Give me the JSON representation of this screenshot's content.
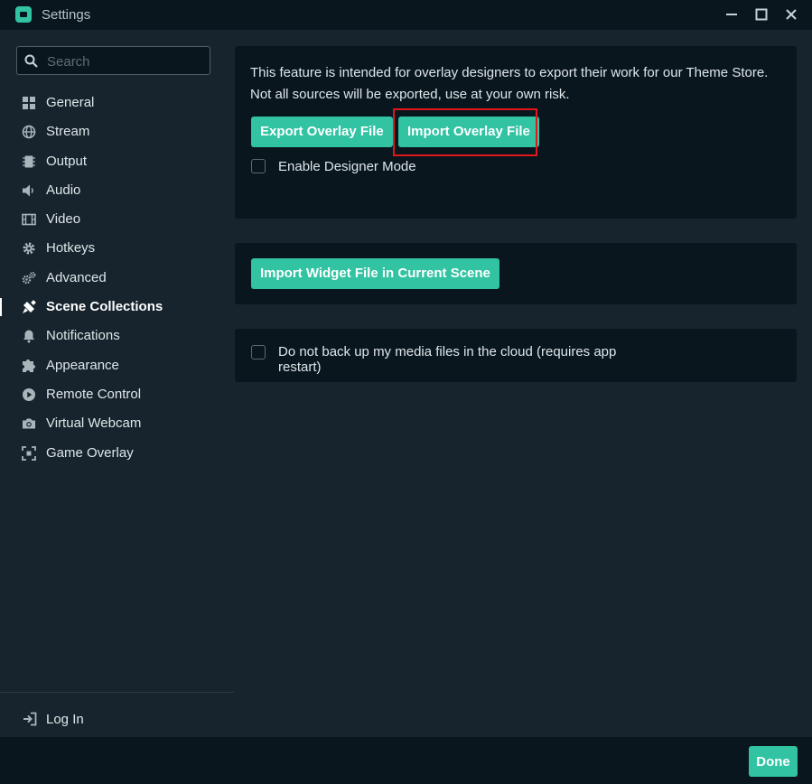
{
  "window": {
    "title": "Settings",
    "controls": {
      "minimize": "—",
      "maximize": "☐",
      "close": "✕"
    }
  },
  "colors": {
    "accent": "#31c3a2",
    "highlight": "#e0181b",
    "card": "#09161d",
    "background": "#17242d"
  },
  "sidebar": {
    "search_placeholder": "Search",
    "items": [
      {
        "label": "General",
        "icon": "grid-icon"
      },
      {
        "label": "Stream",
        "icon": "globe-icon"
      },
      {
        "label": "Output",
        "icon": "chip-icon"
      },
      {
        "label": "Audio",
        "icon": "speaker-icon"
      },
      {
        "label": "Video",
        "icon": "film-icon"
      },
      {
        "label": "Hotkeys",
        "icon": "gear-icon"
      },
      {
        "label": "Advanced",
        "icon": "gears-icon"
      },
      {
        "label": "Scene Collections",
        "icon": "scene-icon",
        "active": true
      },
      {
        "label": "Notifications",
        "icon": "bell-icon"
      },
      {
        "label": "Appearance",
        "icon": "puzzle-icon"
      },
      {
        "label": "Remote Control",
        "icon": "play-circle-icon"
      },
      {
        "label": "Virtual Webcam",
        "icon": "camera-icon"
      },
      {
        "label": "Game Overlay",
        "icon": "expand-icon"
      }
    ],
    "login_label": "Log In"
  },
  "main": {
    "overlay_card": {
      "description_line1": "This feature is intended for overlay designers to export their work for our Theme Store.",
      "description_line2": "Not all sources will be exported, use at your own risk.",
      "export_label": "Export Overlay File",
      "import_label": "Import Overlay File",
      "designer_mode_label": "Enable Designer Mode",
      "designer_mode_checked": false
    },
    "widget_card": {
      "import_widget_label": "Import Widget File in Current Scene"
    },
    "backup_card": {
      "backup_label_line1": "Do not back up my media files in the cloud (requires app",
      "backup_label_line2": "restart)",
      "backup_checked": false
    }
  },
  "footer": {
    "done_label": "Done"
  }
}
